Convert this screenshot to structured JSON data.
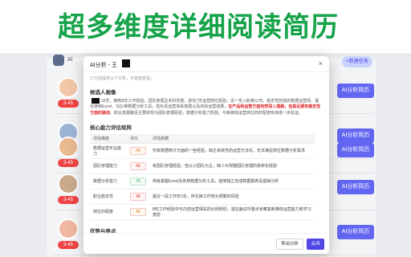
{
  "banner": {
    "title": "超多维度详细阅读简历"
  },
  "background": {
    "robot_label": "Al",
    "top_pill": "+新建任务",
    "rows": [
      {
        "badge": "3-45",
        "button": "AI分析简历",
        "avatar_color": "#f1c7a8"
      },
      {
        "badge": "3-45",
        "button": "AI分析简历",
        "avatar_color": "#9bb4d6"
      },
      {
        "badge": "3-45",
        "button": "AI分析简历",
        "avatar_color": "#e9b98f"
      },
      {
        "badge": "3-45",
        "button": "AI分析简历",
        "avatar_color": "#c9a98a"
      },
      {
        "badge": "3-45",
        "button": "AI分析简历",
        "avatar_color": "#f0b8a0"
      }
    ]
  },
  "modal": {
    "title_prefix": "AI分析 - 王",
    "close_glyph": "×",
    "subtitle": "已为您提供以下分析，可直接查看。",
    "section_candidate": "候选人画像",
    "candidate_text_before": "33岁，拥有8年工作经验，团队管理及本科背景。前任7年运营岗位经验，近一年入职某公司，稳定性较强的数据运营师，擅长使用Excel、SQL等数据分析工具，曾负责运营体系搭建以及实际运营成果，",
    "candidate_highlight": "在产品和运营方面有较深入理解，但是近期有稳定性方面的顾虑",
    "candidate_text_after": "。职业发展路径主要体现为团队管理经验，数据分析能力较强，与新媒体运营岗位的匹配度有待进一步验证。",
    "section_core": "核心能力评估矩阵",
    "table_headers": [
      "评估维度",
      "评分",
      "评估依据"
    ],
    "table_rows": [
      {
        "dim": "数据运营专业能力",
        "score": "45",
        "level": "orange",
        "basis": "仅有数据统计方面的一些经验，缺乏系统性的运营方法论，无法满足岗位数据分析需求"
      },
      {
        "dim": "团队管理能力",
        "score": "40",
        "level": "red",
        "basis": "有团队管理经验，但以小团队为主，缺少大规模团队管理的系统化经验"
      },
      {
        "dim": "数据分析能力",
        "score": "75",
        "level": "green",
        "basis": "熟练掌握Excel及常用数据分析工具，能够独立完成数据报表及基础分析"
      },
      {
        "dim": "职业稳定性",
        "score": "40",
        "level": "red",
        "basis": "最近一段工作仅1年，存在换工作较为频繁的风险"
      },
      {
        "dim": "岗位匹配度",
        "score": "45",
        "level": "orange",
        "basis": "8年工作经验中与内容运营相关的比例较低，需在面试中重点考察其新媒体运营能力和学习意愿"
      }
    ],
    "section_strengths": "优势与亮点",
    "btn_export": "导出分析",
    "btn_close": "关闭"
  },
  "colors": {
    "brand_green": "#16a34a",
    "primary": "#4f46e5",
    "danger": "#dc2626"
  }
}
